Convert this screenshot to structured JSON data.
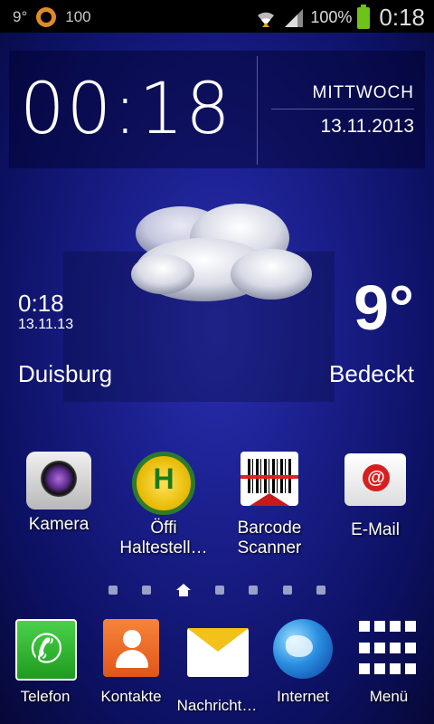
{
  "status_bar": {
    "notif_temp": "9°",
    "notif_count": "100",
    "battery_percent": "100%",
    "time": "0:18",
    "icons": [
      "wifi-icon",
      "signal-icon",
      "battery-icon"
    ]
  },
  "clock_widget": {
    "time": "00:18",
    "day": "MITTWOCH",
    "date": "13.11.2013"
  },
  "weather_widget": {
    "time": "0:18",
    "date": "13.11.13",
    "temperature": "9°",
    "city": "Duisburg",
    "condition": "Bedeckt",
    "icon": "cloud-icon"
  },
  "apps": [
    {
      "label": "Kamera",
      "icon": "camera-icon"
    },
    {
      "label": "Öffi Haltestell…",
      "icon": "bus-stop-icon"
    },
    {
      "label": "Barcode Scanner",
      "icon": "barcode-icon"
    },
    {
      "label": "E-Mail",
      "icon": "email-icon"
    }
  ],
  "pager": {
    "pages": 7,
    "current": 3
  },
  "dock": [
    {
      "label": "Telefon",
      "icon": "phone-icon"
    },
    {
      "label": "Kontakte",
      "icon": "contacts-icon"
    },
    {
      "label": "Nachricht…",
      "icon": "messages-icon"
    },
    {
      "label": "Internet",
      "icon": "globe-icon"
    },
    {
      "label": "Menü",
      "icon": "app-drawer-icon"
    }
  ],
  "colors": {
    "battery": "#6cc31c",
    "wallpaper": "#1a1f8c"
  }
}
